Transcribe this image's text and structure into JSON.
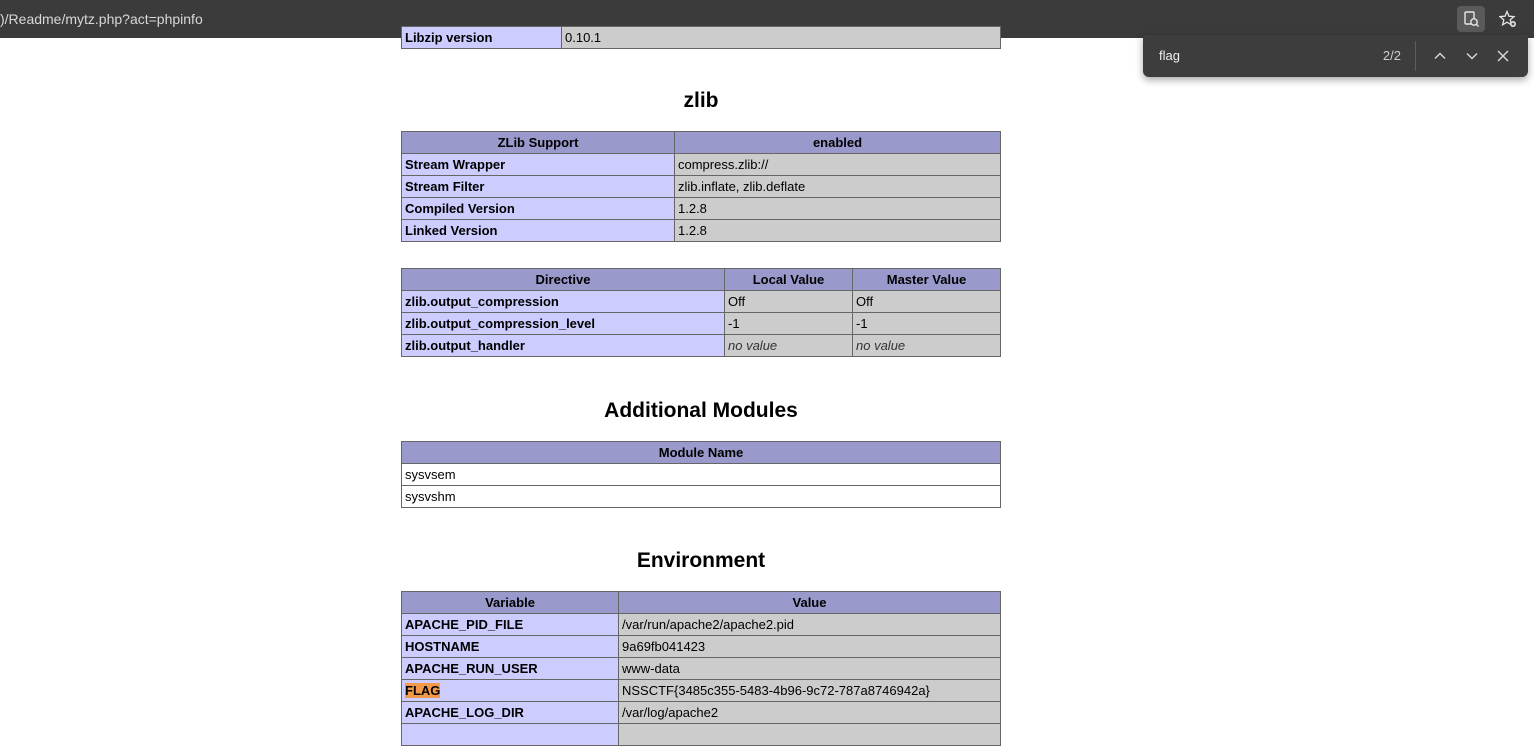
{
  "browser": {
    "url": ")/Readme/mytz.php?act=phpinfo",
    "icons": [
      "reader-mode-icon",
      "favorites-add-icon"
    ]
  },
  "find": {
    "query": "flag",
    "count": "2/2"
  },
  "libzip": {
    "label": "Libzip version",
    "value": "0.10.1"
  },
  "zlib": {
    "title": "zlib",
    "header": [
      "ZLib Support",
      "enabled"
    ],
    "rows": [
      {
        "k": "Stream Wrapper",
        "v": "compress.zlib://"
      },
      {
        "k": "Stream Filter",
        "v": "zlib.inflate, zlib.deflate"
      },
      {
        "k": "Compiled Version",
        "v": "1.2.8"
      },
      {
        "k": "Linked Version",
        "v": "1.2.8"
      }
    ],
    "directives_header": [
      "Directive",
      "Local Value",
      "Master Value"
    ],
    "directives": [
      {
        "k": "zlib.output_compression",
        "local": "Off",
        "master": "Off"
      },
      {
        "k": "zlib.output_compression_level",
        "local": "-1",
        "master": "-1"
      },
      {
        "k": "zlib.output_handler",
        "local": "no value",
        "master": "no value"
      }
    ]
  },
  "additional": {
    "title": "Additional Modules",
    "header": "Module Name",
    "rows": [
      "sysvsem",
      "sysvshm"
    ]
  },
  "environment": {
    "title": "Environment",
    "header": [
      "Variable",
      "Value"
    ],
    "rows": [
      {
        "k": "APACHE_PID_FILE",
        "v": "/var/run/apache2/apache2.pid"
      },
      {
        "k": "HOSTNAME",
        "v": "9a69fb041423"
      },
      {
        "k": "APACHE_RUN_USER",
        "v": "www-data"
      },
      {
        "k": "FLAG",
        "v": "NSSCTF{3485c355-5483-4b96-9c72-787a8746942a}"
      },
      {
        "k": "APACHE_LOG_DIR",
        "v": "/var/log/apache2"
      }
    ]
  }
}
